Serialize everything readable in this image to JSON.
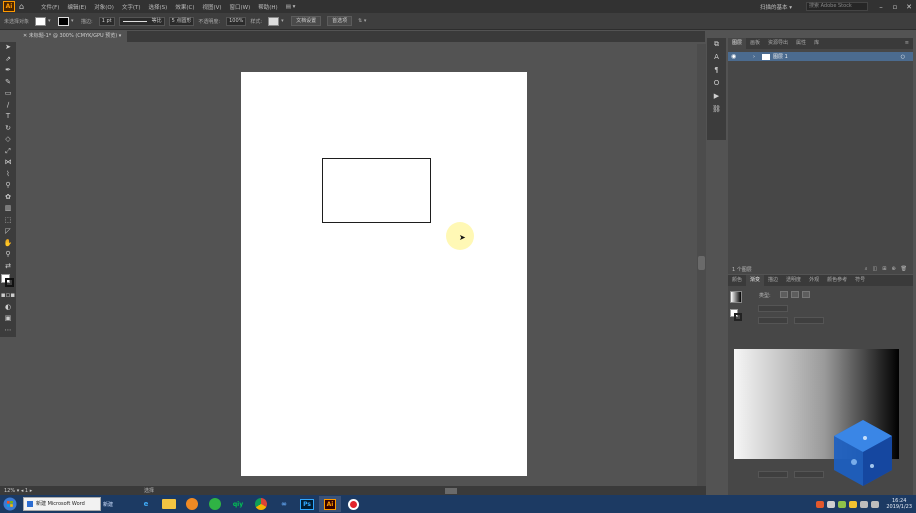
{
  "app": {
    "logo_text": "Ai",
    "home_icon": "home-icon"
  },
  "menu": {
    "items": [
      "文件(F)",
      "编辑(E)",
      "对象(O)",
      "文字(T)",
      "选择(S)",
      "效果(C)",
      "视图(V)",
      "窗口(W)",
      "帮助(H)"
    ],
    "layout_label": "▤ ▾",
    "workspace_label": "扫描的基本 ▾",
    "search_placeholder": "搜索 Adobe Stock"
  },
  "control": {
    "no_selection": "未选择对象",
    "stroke_label": "描边:",
    "stroke_weight": "1 pt",
    "profile_label": "等比",
    "brush_label": "5 点圆形",
    "opacity_label": "不透明度:",
    "opacity_value": "100%",
    "style_label": "样式:",
    "doc_setup": "文档设置",
    "prefs": "首选项"
  },
  "document": {
    "tab_title": "未标题-1* @ 300% (CMYK/GPU 预览)"
  },
  "status": {
    "zoom": "12%",
    "page": "1",
    "tool": "选择"
  },
  "layers": {
    "tabs": [
      "图层",
      "画板",
      "资源导出",
      "属性",
      "库"
    ],
    "active_tab": 0,
    "layer_name": "图层 1",
    "count": "1 个图层"
  },
  "gradient": {
    "tabs": [
      "颜色",
      "渐变",
      "描边",
      "透明度",
      "外观",
      "颜色参考",
      "符号"
    ],
    "active_tab": 1,
    "type_label": "类型:",
    "start": "#f6f6f6",
    "end": "#000000"
  },
  "taskbar": {
    "doc_title": "新建 Microsoft Word",
    "label": "新建",
    "apps": [
      "ie",
      "media",
      "360",
      "iqiyi",
      "chrome",
      "baidu",
      "Ps",
      "Ai",
      "rec"
    ],
    "time": "16:24",
    "date": "2019/1/23"
  },
  "colors": {
    "ui_dark": "#323232",
    "panel": "#474747",
    "canvas": "#535353",
    "selection_blue": "#4b6b8f",
    "taskbar": "#1c3a63"
  }
}
